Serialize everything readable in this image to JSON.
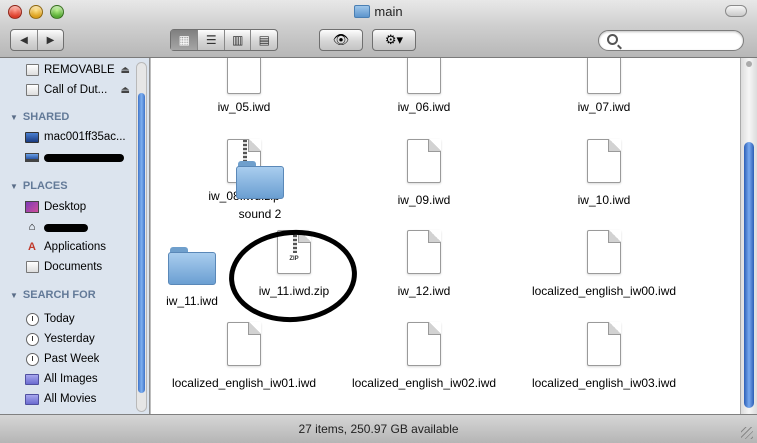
{
  "window": {
    "title": "main"
  },
  "toolbar": {
    "back_icon": "◀",
    "forward_icon": "▶",
    "view_icons": [
      "▦",
      "☰",
      "▥",
      "▤"
    ],
    "quicklook_icon": "👁",
    "action_icon": "⚙▾",
    "search_placeholder": ""
  },
  "sidebar": {
    "devices": [
      {
        "label": "REMOVABLE",
        "icon": "drive-icon",
        "eject": "⏏"
      },
      {
        "label": "Call of Dut...",
        "icon": "drive-icon",
        "eject": "⏏"
      }
    ],
    "shared_heading": "SHARED",
    "shared": [
      {
        "label": "mac001ff35ac...",
        "icon": "monitor-icon"
      },
      {
        "label": "",
        "icon": "laptop-icon"
      }
    ],
    "places_heading": "PLACES",
    "places": [
      {
        "label": "Desktop",
        "icon": "desktop-icon"
      },
      {
        "label": "",
        "icon": "home-icon"
      },
      {
        "label": "Applications",
        "icon": "applications-icon"
      },
      {
        "label": "Documents",
        "icon": "documents-icon"
      }
    ],
    "search_heading": "SEARCH FOR",
    "searches": [
      {
        "label": "Today",
        "icon": "clock-icon"
      },
      {
        "label": "Yesterday",
        "icon": "clock-icon"
      },
      {
        "label": "Past Week",
        "icon": "clock-icon"
      },
      {
        "label": "All Images",
        "icon": "smart-folder-icon"
      },
      {
        "label": "All Movies",
        "icon": "smart-folder-icon"
      }
    ]
  },
  "files": [
    {
      "name": "iw_05.iwd",
      "kind": "document"
    },
    {
      "name": "iw_06.iwd",
      "kind": "document"
    },
    {
      "name": "iw_07.iwd",
      "kind": "document"
    },
    {
      "name": "iw_08.iwd.zip",
      "kind": "zip"
    },
    {
      "name": "sound 2",
      "kind": "folder"
    },
    {
      "name": "iw_09.iwd",
      "kind": "document"
    },
    {
      "name": "iw_10.iwd",
      "kind": "document"
    },
    {
      "name": "iw_11.iwd",
      "kind": "folder"
    },
    {
      "name": "iw_11.iwd.zip",
      "kind": "zip",
      "zip_text": "ZIP"
    },
    {
      "name": "iw_12.iwd",
      "kind": "document"
    },
    {
      "name": "localized_english_iw00.iwd",
      "kind": "document"
    },
    {
      "name": "localized_english_iw01.iwd",
      "kind": "document"
    },
    {
      "name": "localized_english_iw02.iwd",
      "kind": "document"
    },
    {
      "name": "localized_english_iw03.iwd",
      "kind": "document"
    }
  ],
  "status": {
    "text": "27 items, 250.97 GB available"
  }
}
